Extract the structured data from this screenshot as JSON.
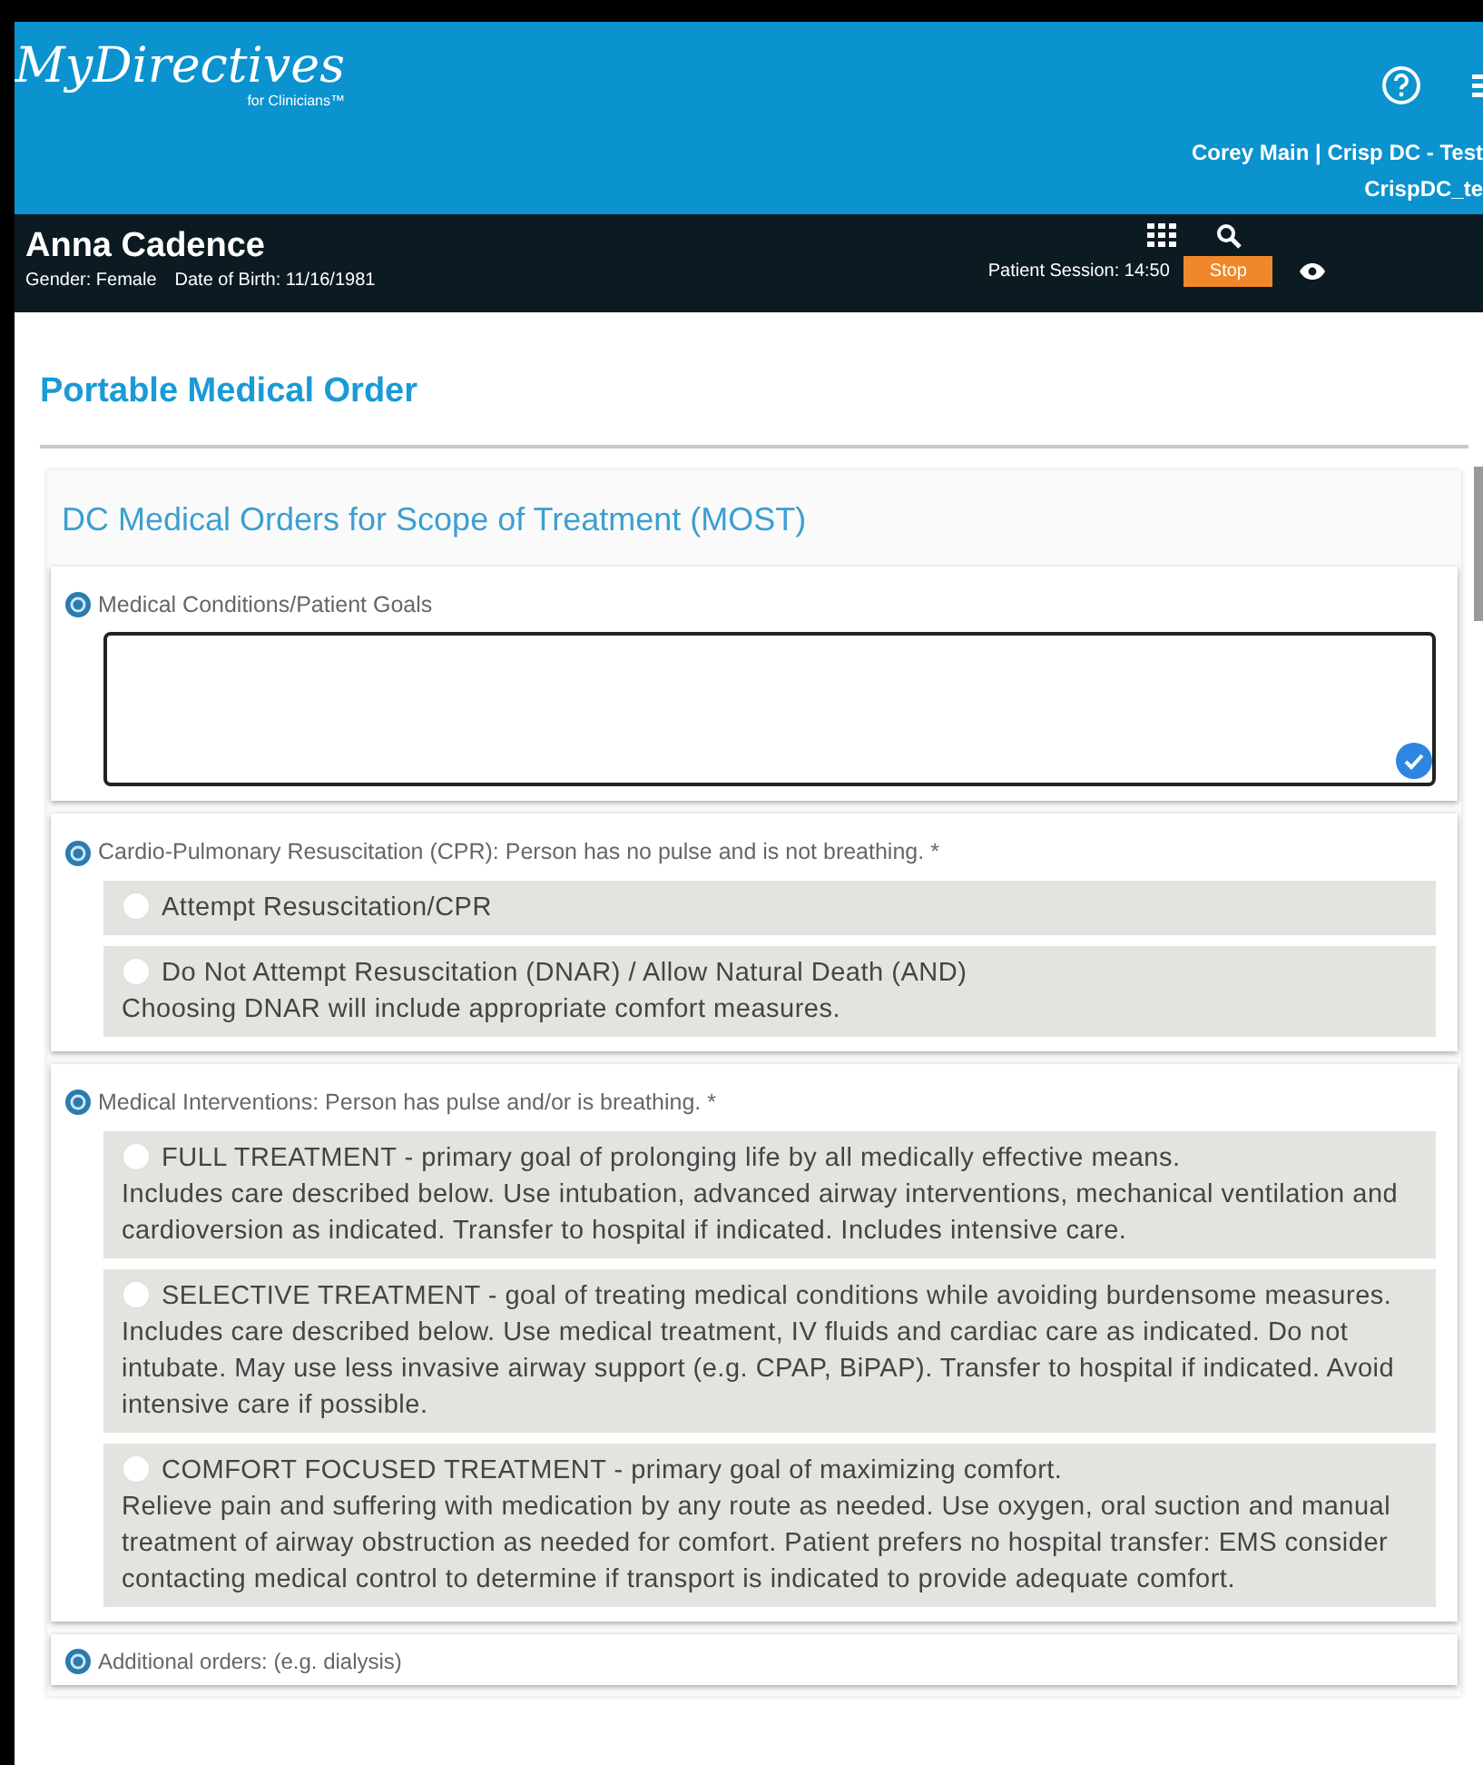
{
  "header": {
    "logo": {
      "wordmark": "MyDirectives",
      "tagline": "for Clinicians™"
    },
    "user_line": "Corey Main | Crisp DC - Test",
    "org_line": "CrispDC_te"
  },
  "patient": {
    "name": "Anna Cadence",
    "gender": "Gender: Female",
    "dob": "Date of Birth: 11/16/1981",
    "session": "Patient Session: 14:50",
    "stop": "Stop"
  },
  "page_title": "Portable Medical Order",
  "form": {
    "title": "DC Medical Orders for Scope of Treatment (MOST)",
    "sections": [
      {
        "kind": "textarea",
        "label": "Medical Conditions/Patient Goals",
        "validated": true
      },
      {
        "kind": "radio",
        "label": "Cardio-Pulmonary Resuscitation (CPR): Person has no pulse and is not breathing. *",
        "options": [
          {
            "label": "Attempt Resuscitation/CPR",
            "selected": false
          },
          {
            "label": "Do Not Attempt Resuscitation (DNAR) / Allow Natural Death (AND)",
            "description": "Choosing DNAR will include appropriate comfort measures.",
            "selected": false
          }
        ]
      },
      {
        "kind": "radio",
        "label": "Medical Interventions: Person has pulse and/or is breathing. *",
        "options": [
          {
            "label": "FULL TREATMENT - primary goal of prolonging life by all medically effective means.",
            "description": "Includes care described below. Use intubation, advanced airway interventions, mechanical ventilation and cardioversion as indicated. Transfer to hospital if indicated. Includes intensive care.",
            "selected": false
          },
          {
            "label": "SELECTIVE TREATMENT - goal of treating medical conditions while avoiding burdensome measures.",
            "description": "Includes care described below. Use medical treatment, IV fluids and cardiac care as indicated. Do not intubate. May use less invasive airway support (e.g. CPAP, BiPAP). Transfer to hospital if indicated. Avoid intensive care if possible.",
            "selected": false
          },
          {
            "label": "COMFORT FOCUSED TREATMENT - primary goal of maximizing comfort.",
            "description": "Relieve pain and suffering with medication by any route as needed. Use oxygen, oral suction and manual treatment of airway obstruction as needed for comfort. Patient prefers no hospital transfer: EMS consider contacting medical control to determine if transport is indicated to provide adequate comfort.",
            "selected": false
          }
        ]
      },
      {
        "kind": "heading",
        "label": "Additional orders: (e.g. dialysis)"
      }
    ]
  }
}
